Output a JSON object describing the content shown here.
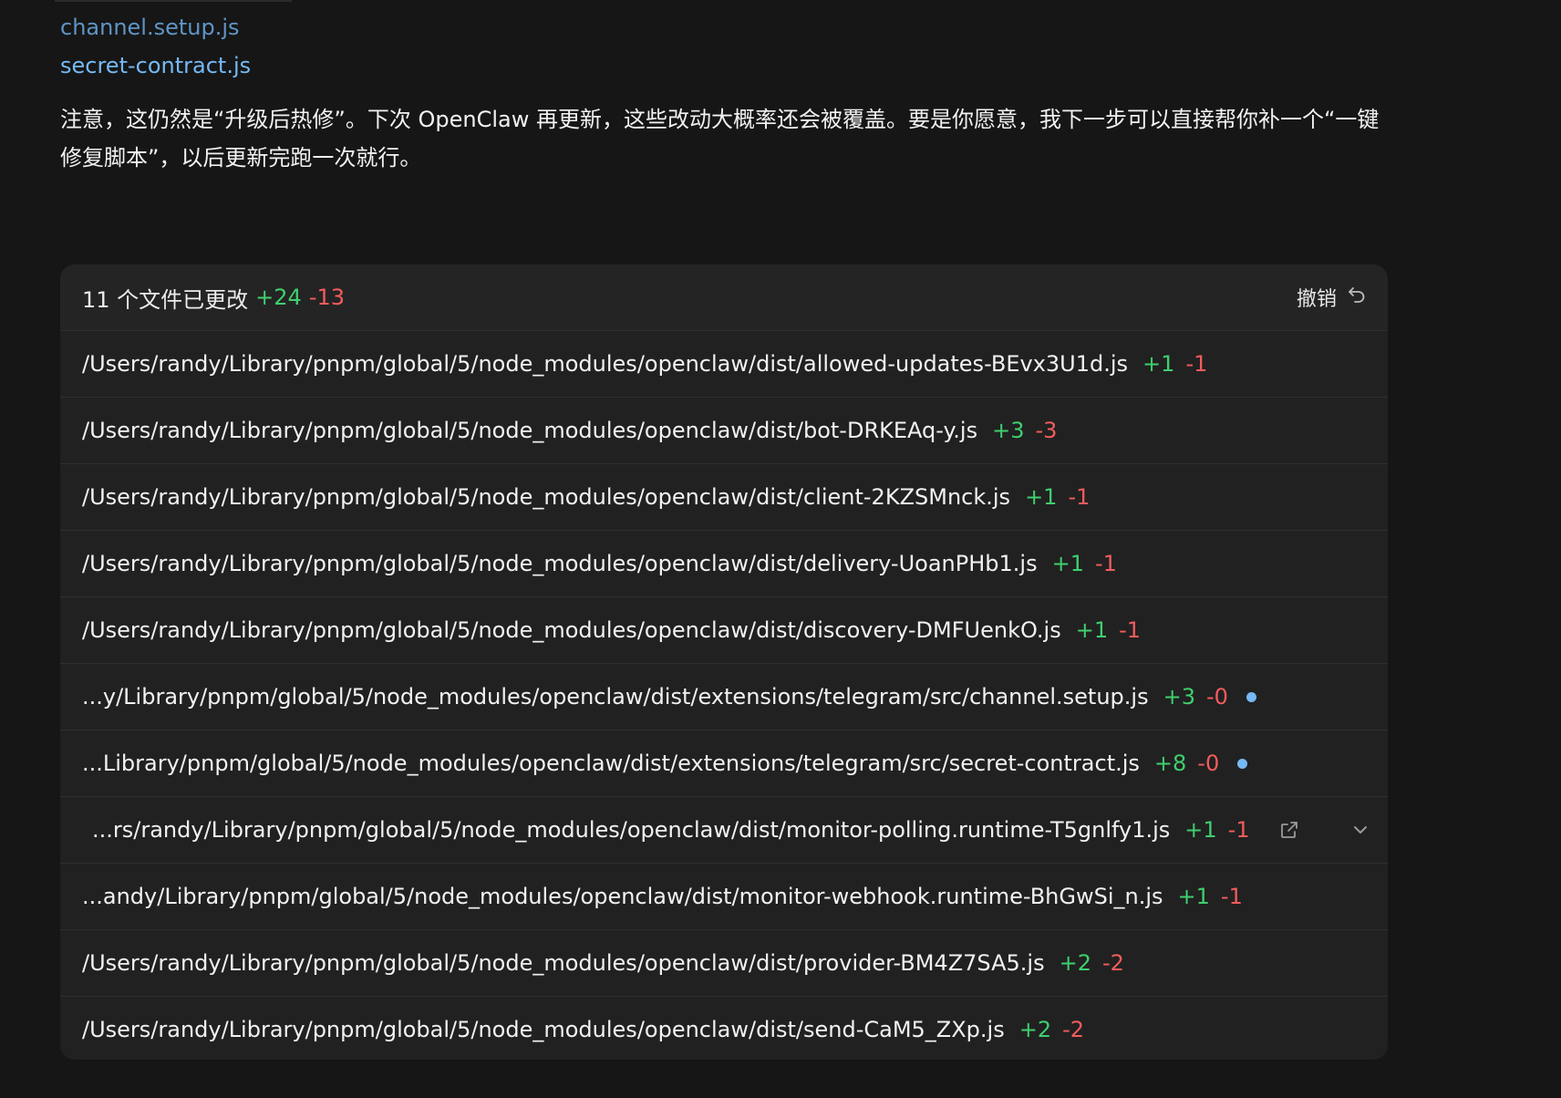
{
  "links": [
    {
      "label": "channel.setup.js"
    },
    {
      "label": "secret-contract.js"
    }
  ],
  "note": "注意，这仍然是“升级后热修”。下次 OpenClaw 再更新，这些改动大概率还会被覆盖。要是你愿意，我下一步可以直接帮你补一个“一键修复脚本”，以后更新完跑一次就行。",
  "changes": {
    "summary_label": "11 个文件已更改",
    "total_added": "+24",
    "total_removed": "-13",
    "undo_label": "撤销",
    "files": [
      {
        "path": "/Users/randy/Library/pnpm/global/5/node_modules/openclaw/dist/allowed-updates-BEvx3U1d.js",
        "added": "+1",
        "removed": "-1"
      },
      {
        "path": "/Users/randy/Library/pnpm/global/5/node_modules/openclaw/dist/bot-DRKEAq-y.js",
        "added": "+3",
        "removed": "-3"
      },
      {
        "path": "/Users/randy/Library/pnpm/global/5/node_modules/openclaw/dist/client-2KZSMnck.js",
        "added": "+1",
        "removed": "-1"
      },
      {
        "path": "/Users/randy/Library/pnpm/global/5/node_modules/openclaw/dist/delivery-UoanPHb1.js",
        "added": "+1",
        "removed": "-1"
      },
      {
        "path": "/Users/randy/Library/pnpm/global/5/node_modules/openclaw/dist/discovery-DMFUenkO.js",
        "added": "+1",
        "removed": "-1"
      },
      {
        "path": "...y/Library/pnpm/global/5/node_modules/openclaw/dist/extensions/telegram/src/channel.setup.js",
        "added": "+3",
        "removed": "-0",
        "new_file": true
      },
      {
        "path": "...Library/pnpm/global/5/node_modules/openclaw/dist/extensions/telegram/src/secret-contract.js",
        "added": "+8",
        "removed": "-0",
        "new_file": true
      },
      {
        "path": "...rs/randy/Library/pnpm/global/5/node_modules/openclaw/dist/monitor-polling.runtime-T5gnlfy1.js",
        "added": "+1",
        "removed": "-1",
        "hovered": true
      },
      {
        "path": "...andy/Library/pnpm/global/5/node_modules/openclaw/dist/monitor-webhook.runtime-BhGwSi_n.js",
        "added": "+1",
        "removed": "-1"
      },
      {
        "path": "/Users/randy/Library/pnpm/global/5/node_modules/openclaw/dist/provider-BM4Z7SA5.js",
        "added": "+2",
        "removed": "-2"
      },
      {
        "path": "/Users/randy/Library/pnpm/global/5/node_modules/openclaw/dist/send-CaM5_ZXp.js",
        "added": "+2",
        "removed": "-2"
      }
    ]
  },
  "icons": {
    "undo": "undo-icon",
    "open_external": "open-external-icon",
    "expand": "chevron-down-icon",
    "new_file_marker": "dot-icon"
  },
  "colors": {
    "background": "#161616",
    "panel": "#212121",
    "link": "#76b9f5",
    "added": "#3fcf6e",
    "removed": "#f25c5c"
  }
}
